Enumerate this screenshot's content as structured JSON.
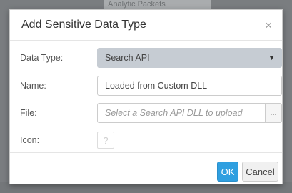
{
  "background": {
    "strip_text": "Analytic Packets"
  },
  "dialog": {
    "title": "Add Sensitive Data Type",
    "close_glyph": "×",
    "fields": {
      "data_type": {
        "label": "Data Type:",
        "value": "Search API",
        "caret_icon": "caret-down-icon"
      },
      "name": {
        "label": "Name:",
        "value": "Loaded from Custom DLL"
      },
      "file": {
        "label": "File:",
        "placeholder": "Select a Search API DLL to upload",
        "browse_label": "..."
      },
      "icon": {
        "label": "Icon:",
        "glyph": "?"
      }
    },
    "footer": {
      "ok_label": "OK",
      "cancel_label": "Cancel"
    }
  },
  "colors": {
    "ok_button": "#2f9fe0",
    "select_bg": "#c6ccd3",
    "overlay": "#7a7d80"
  }
}
